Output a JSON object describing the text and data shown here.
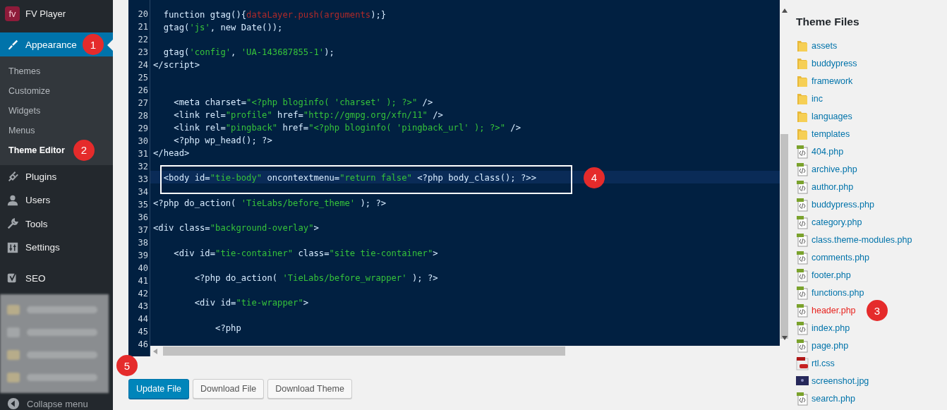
{
  "sidebar": {
    "brand": {
      "logo": "fv",
      "label": "FV Player"
    },
    "items": [
      {
        "label": "Appearance",
        "selected": true,
        "badge": "1",
        "children": [
          {
            "label": "Themes",
            "selected": false
          },
          {
            "label": "Customize",
            "selected": false
          },
          {
            "label": "Widgets",
            "selected": false
          },
          {
            "label": "Menus",
            "selected": false
          },
          {
            "label": "Theme Editor",
            "selected": true,
            "badge": "2"
          }
        ]
      },
      {
        "label": "Plugins",
        "selected": false
      },
      {
        "label": "Users",
        "selected": false
      },
      {
        "label": "Tools",
        "selected": false
      },
      {
        "label": "Settings",
        "selected": false
      },
      {
        "label": "SEO",
        "selected": false
      }
    ],
    "collapse_label": "Collapse menu"
  },
  "editor": {
    "lines": [
      {
        "number": "20",
        "highlighted": false,
        "tokens": [
          {
            "text": "  function gtag(){",
            "kind": "plain"
          },
          {
            "text": "dataLayer.push(",
            "kind": "red"
          },
          {
            "text": "arguments",
            "kind": "red"
          },
          {
            "text": ");}",
            "kind": "plain"
          }
        ]
      },
      {
        "number": "21",
        "highlighted": false,
        "tokens": [
          {
            "text": "  gtag(",
            "kind": "plain"
          },
          {
            "text": "'js'",
            "kind": "string"
          },
          {
            "text": ", new Date());",
            "kind": "plain"
          }
        ]
      },
      {
        "number": "22",
        "highlighted": false
      },
      {
        "number": "23",
        "highlighted": false,
        "tokens": [
          {
            "text": "  gtag(",
            "kind": "plain"
          },
          {
            "text": "'config'",
            "kind": "string"
          },
          {
            "text": ", ",
            "kind": "plain"
          },
          {
            "text": "'UA-143687855-1'",
            "kind": "string"
          },
          {
            "text": ");",
            "kind": "plain"
          }
        ]
      },
      {
        "number": "24",
        "highlighted": false,
        "tokens": [
          {
            "text": "</script>",
            "kind": "plain"
          }
        ]
      },
      {
        "number": "25",
        "highlighted": false
      },
      {
        "number": "26",
        "highlighted": false
      },
      {
        "number": "27",
        "highlighted": false,
        "tokens": [
          {
            "text": "    <meta charset=",
            "kind": "plain"
          },
          {
            "text": "\"<?php bloginfo( 'charset' ); ?>\"",
            "kind": "string"
          },
          {
            "text": " />",
            "kind": "plain"
          }
        ]
      },
      {
        "number": "28",
        "highlighted": false,
        "tokens": [
          {
            "text": "    <link rel=",
            "kind": "plain"
          },
          {
            "text": "\"profile\"",
            "kind": "string"
          },
          {
            "text": " href=",
            "kind": "plain"
          },
          {
            "text": "\"http://gmpg.org/xfn/11\"",
            "kind": "string"
          },
          {
            "text": " />",
            "kind": "plain"
          }
        ]
      },
      {
        "number": "29",
        "highlighted": false,
        "tokens": [
          {
            "text": "    <link rel=",
            "kind": "plain"
          },
          {
            "text": "\"pingback\"",
            "kind": "string"
          },
          {
            "text": " href=",
            "kind": "plain"
          },
          {
            "text": "\"<?php bloginfo( 'pingback_url' ); ?>\"",
            "kind": "string"
          },
          {
            "text": " />",
            "kind": "plain"
          }
        ]
      },
      {
        "number": "30",
        "highlighted": false,
        "tokens": [
          {
            "text": "    <?php wp_head(); ?>",
            "kind": "plain"
          }
        ]
      },
      {
        "number": "31",
        "highlighted": false,
        "tokens": [
          {
            "text": "</head>",
            "kind": "plain"
          }
        ]
      },
      {
        "number": "32",
        "highlighted": false
      },
      {
        "number": "33",
        "highlighted": true,
        "framed": true,
        "badge": "4",
        "tokens": [
          {
            "text": "  <body id=",
            "kind": "plain"
          },
          {
            "text": "\"tie-body\"",
            "kind": "string"
          },
          {
            "text": " oncontextmenu=",
            "kind": "plain"
          },
          {
            "text": "\"return false\"",
            "kind": "string"
          },
          {
            "text": " <?php body_class(); ?>>",
            "kind": "plain"
          }
        ]
      },
      {
        "number": "34",
        "highlighted": false
      },
      {
        "number": "35",
        "highlighted": false,
        "tokens": [
          {
            "text": "<?php do_action( ",
            "kind": "plain"
          },
          {
            "text": "'TieLabs/before_theme'",
            "kind": "string"
          },
          {
            "text": " ); ?>",
            "kind": "plain"
          }
        ]
      },
      {
        "number": "36",
        "highlighted": false
      },
      {
        "number": "37",
        "highlighted": false,
        "tokens": [
          {
            "text": "<div class=",
            "kind": "plain"
          },
          {
            "text": "\"background-overlay\"",
            "kind": "string"
          },
          {
            "text": ">",
            "kind": "plain"
          }
        ]
      },
      {
        "number": "38",
        "highlighted": false
      },
      {
        "number": "39",
        "highlighted": false,
        "tokens": [
          {
            "text": "    <div id=",
            "kind": "plain"
          },
          {
            "text": "\"tie-container\"",
            "kind": "string"
          },
          {
            "text": " class=",
            "kind": "plain"
          },
          {
            "text": "\"site tie-container\"",
            "kind": "string"
          },
          {
            "text": ">",
            "kind": "plain"
          }
        ]
      },
      {
        "number": "40",
        "highlighted": false
      },
      {
        "number": "41",
        "highlighted": false,
        "tokens": [
          {
            "text": "        <?php do_action( ",
            "kind": "plain"
          },
          {
            "text": "'TieLabs/before_wrapper'",
            "kind": "string"
          },
          {
            "text": " ); ?>",
            "kind": "plain"
          }
        ]
      },
      {
        "number": "42",
        "highlighted": false
      },
      {
        "number": "43",
        "highlighted": false,
        "tokens": [
          {
            "text": "        <div id=",
            "kind": "plain"
          },
          {
            "text": "\"tie-wrapper\"",
            "kind": "string"
          },
          {
            "text": ">",
            "kind": "plain"
          }
        ]
      },
      {
        "number": "44",
        "highlighted": false
      },
      {
        "number": "45",
        "highlighted": false,
        "tokens": [
          {
            "text": "            <?php",
            "kind": "plain"
          }
        ]
      },
      {
        "number": "46",
        "highlighted": false
      }
    ]
  },
  "buttons": [
    {
      "label": "Update File",
      "kind": "primary",
      "badge": "5"
    },
    {
      "label": "Download File",
      "kind": "secondary"
    },
    {
      "label": "Download Theme",
      "kind": "secondary"
    }
  ],
  "theme_files": {
    "title": "Theme Files",
    "items": [
      {
        "name": "assets",
        "kind": "folder",
        "selected": false
      },
      {
        "name": "buddypress",
        "kind": "folder",
        "selected": false
      },
      {
        "name": "framework",
        "kind": "folder",
        "selected": false
      },
      {
        "name": "inc",
        "kind": "folder",
        "selected": false
      },
      {
        "name": "languages",
        "kind": "folder",
        "selected": false
      },
      {
        "name": "templates",
        "kind": "folder",
        "selected": false
      },
      {
        "name": "404.php",
        "kind": "php",
        "selected": false
      },
      {
        "name": "archive.php",
        "kind": "php",
        "selected": false
      },
      {
        "name": "author.php",
        "kind": "php",
        "selected": false
      },
      {
        "name": "buddypress.php",
        "kind": "php",
        "selected": false
      },
      {
        "name": "category.php",
        "kind": "php",
        "selected": false
      },
      {
        "name": "class.theme-modules.php",
        "kind": "php",
        "selected": false
      },
      {
        "name": "comments.php",
        "kind": "php",
        "selected": false
      },
      {
        "name": "footer.php",
        "kind": "php",
        "selected": false
      },
      {
        "name": "functions.php",
        "kind": "php",
        "selected": false
      },
      {
        "name": "header.php",
        "kind": "php",
        "selected": true,
        "badge": "3"
      },
      {
        "name": "index.php",
        "kind": "php",
        "selected": false
      },
      {
        "name": "page.php",
        "kind": "php",
        "selected": false
      },
      {
        "name": "rtl.css",
        "kind": "css",
        "selected": false
      },
      {
        "name": "screenshot.jpg",
        "kind": "image",
        "selected": false
      },
      {
        "name": "search.php",
        "kind": "php",
        "selected": false
      }
    ]
  }
}
